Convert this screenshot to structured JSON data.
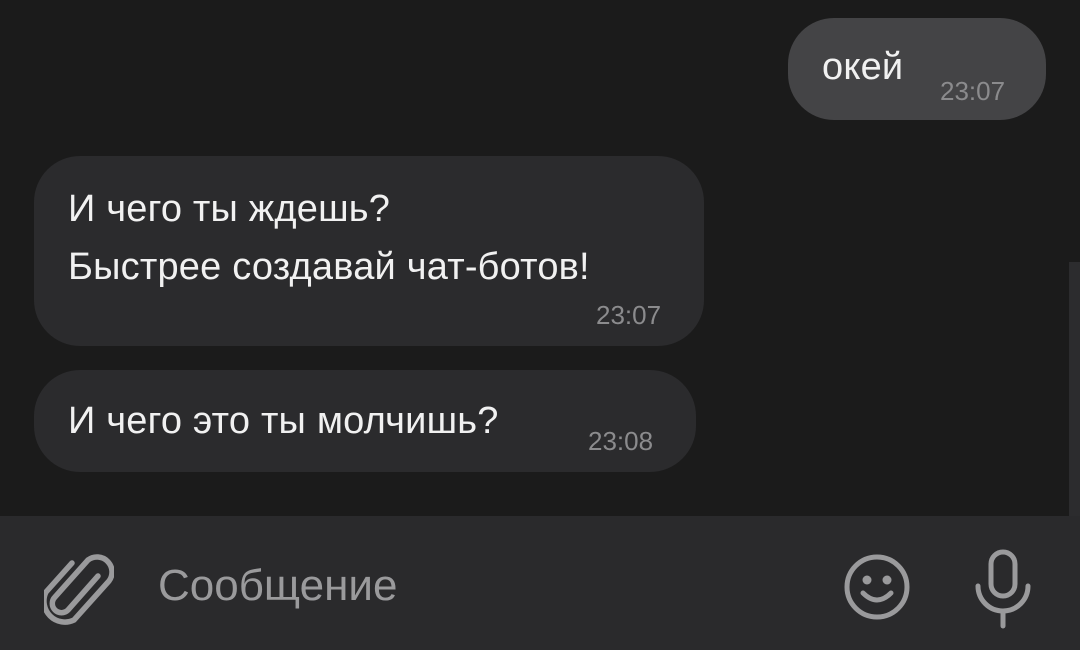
{
  "messages": [
    {
      "direction": "outgoing",
      "text": "окей",
      "time": "23:07"
    },
    {
      "direction": "incoming",
      "lines": [
        "И чего ты ждешь?",
        "Быстрее создавай чат-ботов!"
      ],
      "time": "23:07"
    },
    {
      "direction": "incoming",
      "text": "И чего это ты молчишь?",
      "time": "23:08"
    }
  ],
  "composer": {
    "placeholder": "Сообщение",
    "attach_icon": "paperclip-icon",
    "emoji_icon": "smiley-icon",
    "mic_icon": "microphone-icon"
  },
  "colors": {
    "background": "#1b1b1b",
    "incoming_bubble": "#2b2b2d",
    "outgoing_bubble": "#444446",
    "composer_bg": "#2a2a2c",
    "text": "#f1f1f1",
    "muted": "#8b8b8d"
  }
}
